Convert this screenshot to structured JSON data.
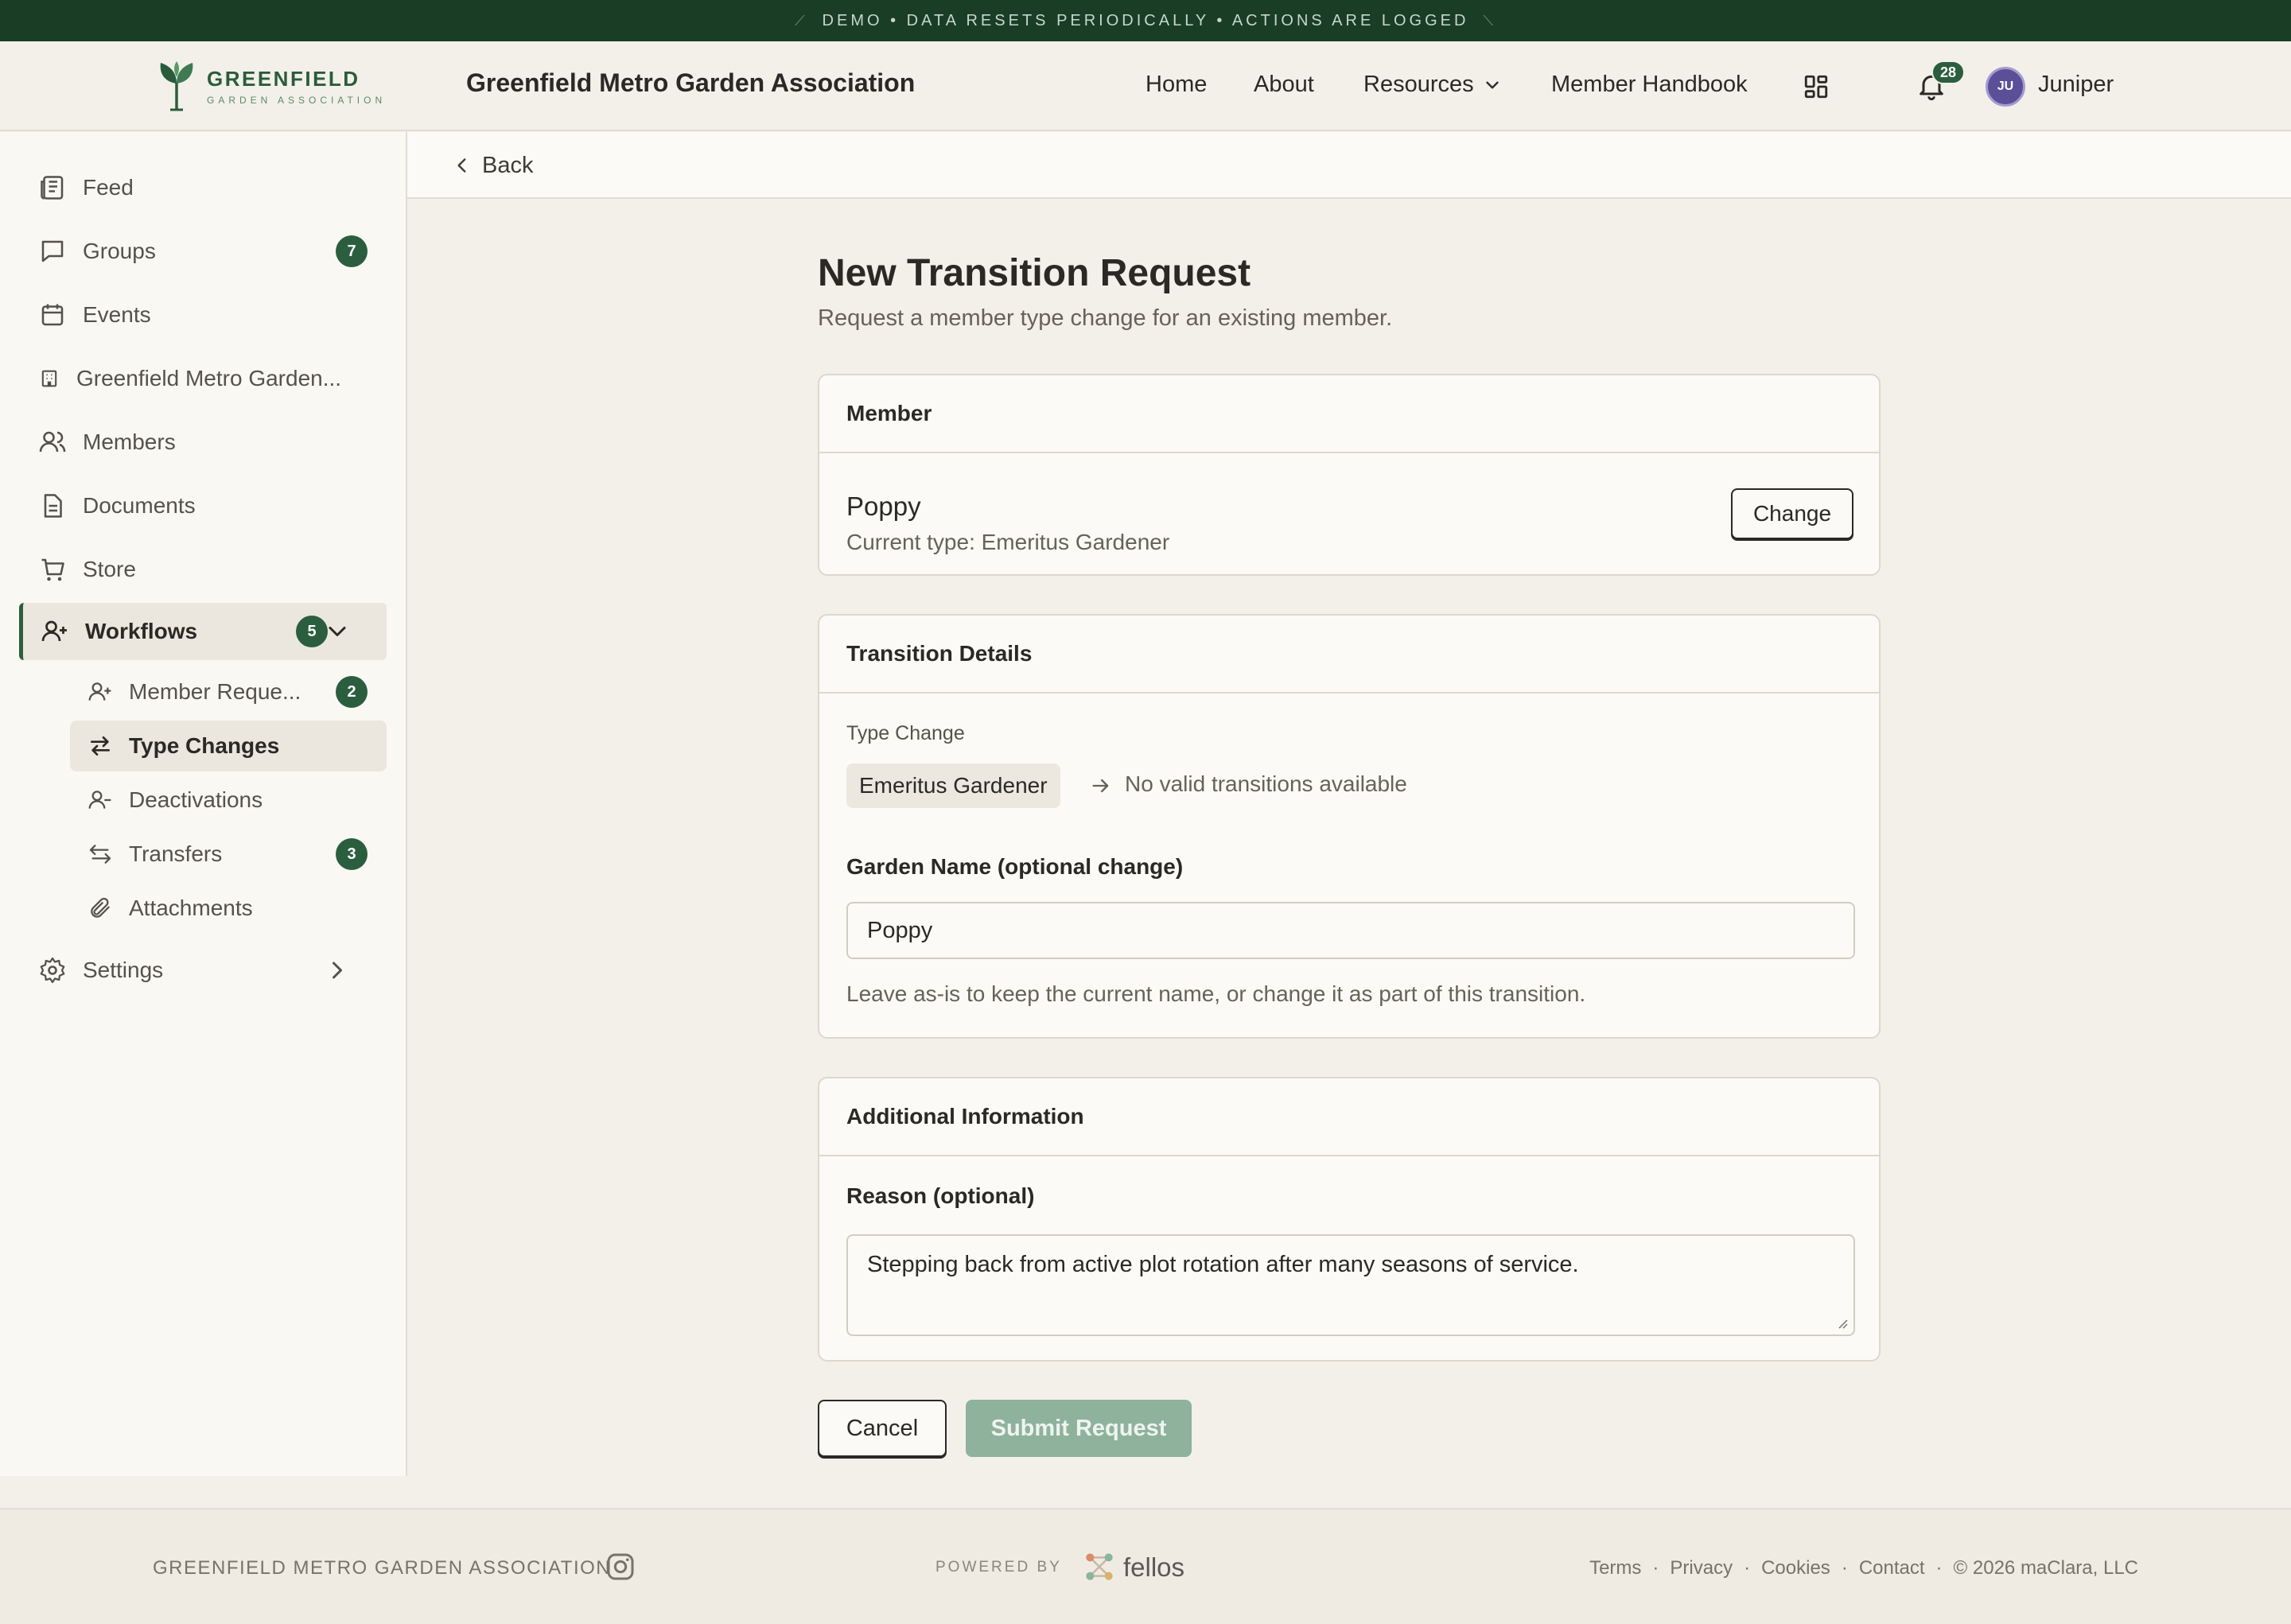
{
  "banner": {
    "text": "DEMO • DATA RESETS PERIODICALLY • ACTIONS ARE LOGGED"
  },
  "header": {
    "logo_name": "GREENFIELD",
    "logo_sub": "GARDEN ASSOCIATION",
    "title": "Greenfield Metro Garden Association",
    "nav": {
      "home": "Home",
      "about": "About",
      "resources": "Resources",
      "handbook": "Member Handbook"
    },
    "notifications": "28",
    "avatar_initials": "JU",
    "user_name": "Juniper"
  },
  "sidebar": {
    "items": [
      {
        "label": "Feed",
        "icon": "newspaper-icon"
      },
      {
        "label": "Groups",
        "icon": "chat-icon",
        "badge": "7"
      },
      {
        "label": "Events",
        "icon": "calendar-icon"
      },
      {
        "label": "Greenfield Metro Garden...",
        "icon": "building-icon"
      },
      {
        "label": "Members",
        "icon": "users-icon"
      },
      {
        "label": "Documents",
        "icon": "document-icon"
      },
      {
        "label": "Store",
        "icon": "cart-icon"
      }
    ],
    "workflows": {
      "label": "Workflows",
      "badge": "5"
    },
    "sub_items": [
      {
        "label": "Member Reque...",
        "badge": "2"
      },
      {
        "label": "Type Changes"
      },
      {
        "label": "Deactivations"
      },
      {
        "label": "Transfers",
        "badge": "3"
      },
      {
        "label": "Attachments"
      }
    ],
    "settings": {
      "label": "Settings"
    }
  },
  "main": {
    "back": "Back",
    "title": "New Transition Request",
    "subtitle": "Request a member type change for an existing member.",
    "member_card": {
      "heading": "Member",
      "name": "Poppy",
      "current_type": "Current type: Emeritus Gardener",
      "change_label": "Change"
    },
    "details_card": {
      "heading": "Transition Details",
      "type_change_label": "Type Change",
      "from_type": "Emeritus Gardener",
      "no_transitions": "No valid transitions available",
      "garden_name_label": "Garden Name (optional change)",
      "garden_name_value": "Poppy",
      "garden_name_help": "Leave as-is to keep the current name, or change it as part of this transition."
    },
    "additional_card": {
      "heading": "Additional Information",
      "reason_label": "Reason (optional)",
      "reason_value": "Stepping back from active plot rotation after many seasons of service."
    },
    "cancel_label": "Cancel",
    "submit_label": "Submit Request"
  },
  "footer": {
    "org": "GREENFIELD METRO GARDEN ASSOCIATION",
    "powered_by": "POWERED BY",
    "brand": "fellos",
    "links": [
      "Terms",
      "Privacy",
      "Cookies",
      "Contact"
    ],
    "copyright": "© 2026 maClara, LLC"
  },
  "colors": {
    "brand_green": "#2b5e3f",
    "banner": "#1a3d26",
    "submit_disabled": "#8fb29d",
    "background": "#f3f0e9"
  }
}
